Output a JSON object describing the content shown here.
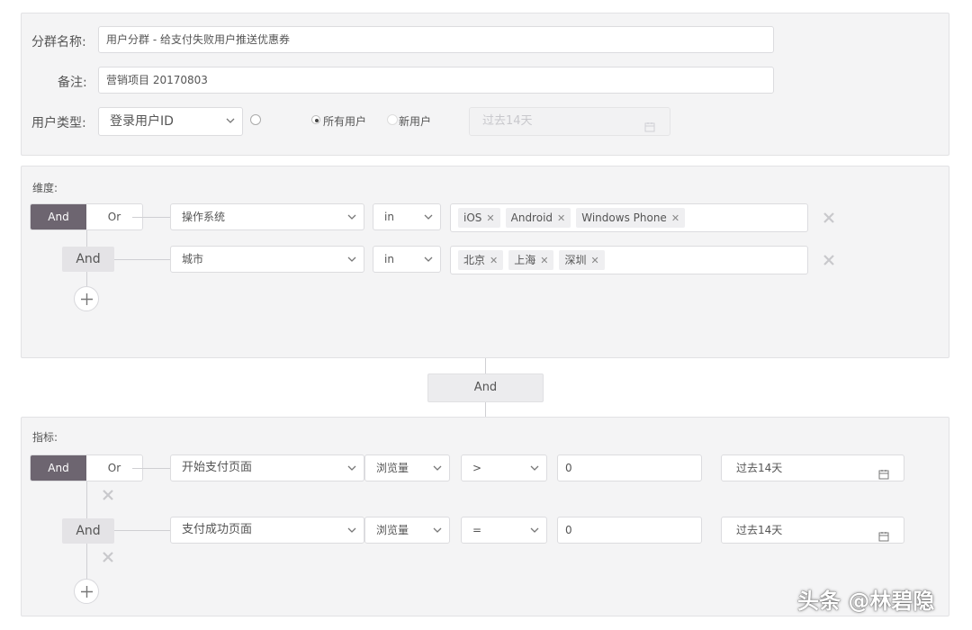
{
  "group_info": {
    "name_label": "分群名称:",
    "name_value": "用户分群 - 给支付失败用户推送优惠券",
    "remark_label": "备注:",
    "remark_value": "营销项目 20170803",
    "user_type_label": "用户类型:",
    "user_type_value": "登录用户ID",
    "radio_all": "所有用户",
    "radio_new": "新用户",
    "time_range_disabled": "过去14天"
  },
  "dimensions": {
    "title": "维度:",
    "and_label": "And",
    "or_label": "Or",
    "row_connector": "And",
    "rows": [
      {
        "field": "操作系统",
        "operator": "in",
        "tags": [
          "iOS",
          "Android",
          "Windows Phone"
        ]
      },
      {
        "field": "城市",
        "operator": "in",
        "tags": [
          "北京",
          "上海",
          "深圳"
        ]
      }
    ]
  },
  "between_connector": "And",
  "metrics": {
    "title": "指标:",
    "and_label": "And",
    "or_label": "Or",
    "row_connector": "And",
    "rows": [
      {
        "page": "开始支付页面",
        "measure": "浏览量",
        "operator": ">",
        "value": "0",
        "time_range": "过去14天"
      },
      {
        "page": "支付成功页面",
        "measure": "浏览量",
        "operator": "=",
        "value": "0",
        "time_range": "过去14天"
      }
    ]
  },
  "watermark": "头条 @林碧隐",
  "colors": {
    "active_segment": "#6d6570",
    "panel_bg": "#f4f4f5"
  }
}
